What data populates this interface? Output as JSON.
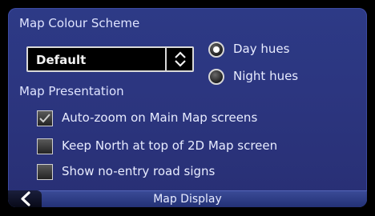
{
  "colour_scheme": {
    "title": "Map Colour Scheme",
    "dropdown_value": "Default",
    "hues": [
      {
        "label": "Day hues",
        "selected": true
      },
      {
        "label": "Night hues",
        "selected": false
      }
    ]
  },
  "presentation": {
    "title": "Map Presentation",
    "options": [
      {
        "label": "Auto-zoom on Main Map screens",
        "checked": true
      },
      {
        "label": "Keep North at top of 2D Map screen",
        "checked": false
      },
      {
        "label": "Show no-entry road signs",
        "checked": false
      }
    ]
  },
  "footer": {
    "title": "Map Display"
  },
  "icons": {
    "back": "chevron-left-icon",
    "dropdown": "up-down-arrows-icon",
    "check": "checkmark-icon"
  }
}
